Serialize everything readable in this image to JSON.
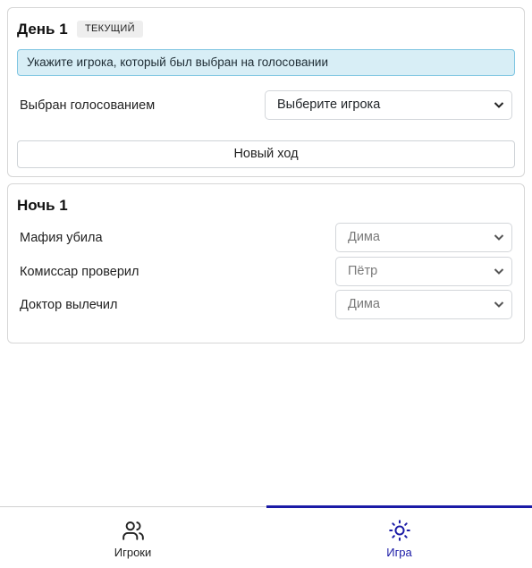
{
  "day": {
    "title": "День 1",
    "badge": "ТЕКУЩИЙ",
    "alert": "Укажите игрока, который был выбран на голосовании",
    "vote_label": "Выбран голосованием",
    "vote_select_value": "Выберите игрока",
    "new_turn_button": "Новый ход"
  },
  "night": {
    "title": "Ночь 1",
    "rows": [
      {
        "label": "Мафия убила",
        "value": "Дима"
      },
      {
        "label": "Комиссар проверил",
        "value": "Пётр"
      },
      {
        "label": "Доктор вылечил",
        "value": "Дима"
      }
    ]
  },
  "bottom_nav": {
    "tabs": [
      {
        "label": "Игроки",
        "icon": "users-icon",
        "active": false
      },
      {
        "label": "Игра",
        "icon": "sun-icon",
        "active": true
      }
    ],
    "active_color": "#1a1aa6"
  }
}
